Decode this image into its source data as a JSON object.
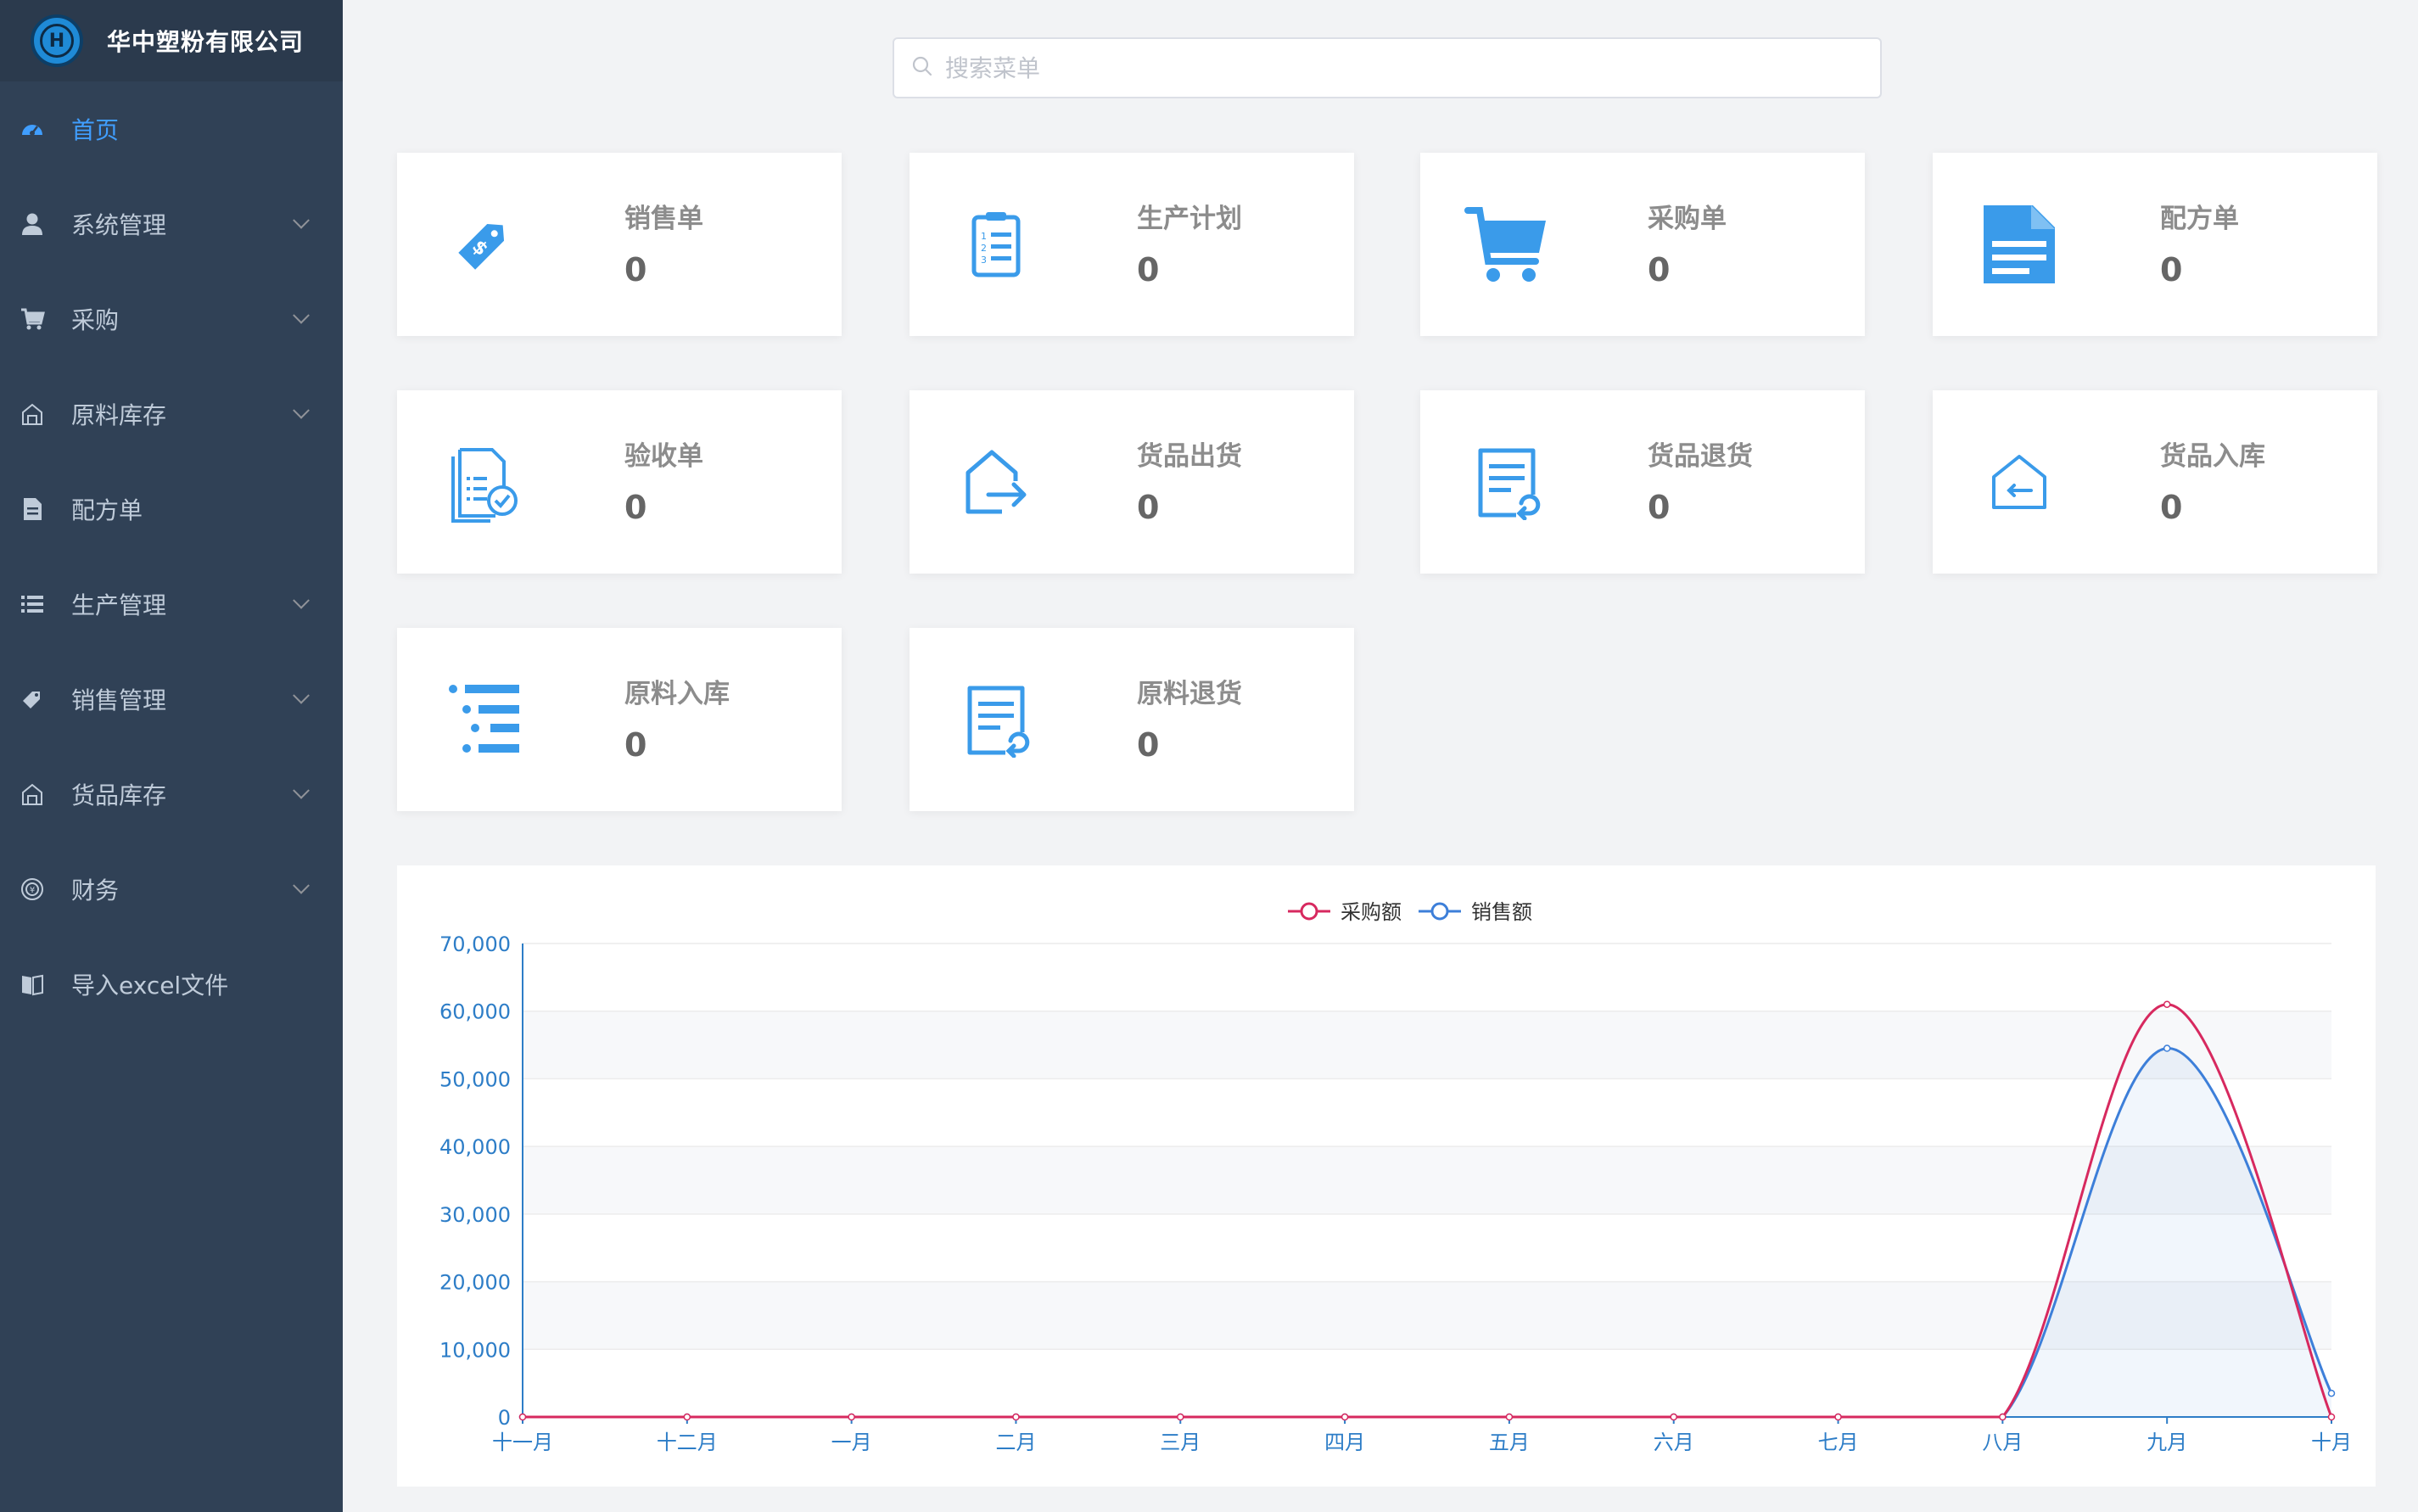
{
  "app": {
    "name": "华中塑粉有限公司",
    "logo_letter": "H"
  },
  "sidebar": {
    "items": [
      {
        "label": "首页",
        "icon": "dashboard-icon",
        "active": true,
        "has_arrow": false
      },
      {
        "label": "系统管理",
        "icon": "user-icon",
        "has_arrow": true
      },
      {
        "label": "采购",
        "icon": "cart-icon",
        "has_arrow": true
      },
      {
        "label": "原料库存",
        "icon": "warehouse-icon",
        "has_arrow": true
      },
      {
        "label": "配方单",
        "icon": "document-icon",
        "has_arrow": false
      },
      {
        "label": "生产管理",
        "icon": "list-icon",
        "has_arrow": true
      },
      {
        "label": "销售管理",
        "icon": "tag-icon",
        "has_arrow": true
      },
      {
        "label": "货品库存",
        "icon": "warehouse-icon",
        "has_arrow": true
      },
      {
        "label": "财务",
        "icon": "coin-icon",
        "has_arrow": true
      },
      {
        "label": "导入excel文件",
        "icon": "book-icon",
        "has_arrow": false
      }
    ]
  },
  "search": {
    "placeholder": "搜索菜单"
  },
  "cards": [
    {
      "title": "销售单",
      "value": "0",
      "icon": "price-tag-icon"
    },
    {
      "title": "生产计划",
      "value": "0",
      "icon": "clipboard-list-icon"
    },
    {
      "title": "采购单",
      "value": "0",
      "icon": "cart-icon"
    },
    {
      "title": "配方单",
      "value": "0",
      "icon": "document-icon"
    },
    {
      "title": "验收单",
      "value": "0",
      "icon": "document-check-icon"
    },
    {
      "title": "货品出货",
      "value": "0",
      "icon": "house-export-icon"
    },
    {
      "title": "货品退货",
      "value": "0",
      "icon": "document-return-icon"
    },
    {
      "title": "货品入库",
      "value": "0",
      "icon": "house-import-icon"
    },
    {
      "title": "原料入库",
      "value": "0",
      "icon": "list-indent-icon"
    },
    {
      "title": "原料退货",
      "value": "0",
      "icon": "document-return-icon"
    }
  ],
  "colors": {
    "accent": "#409eff",
    "icon_blue": "#3a9bea",
    "purchase_line": "#d7295f",
    "sales_line": "#3d7fd9",
    "sidebar_bg": "#304156"
  },
  "chart_data": {
    "type": "line",
    "categories": [
      "十一月",
      "十二月",
      "一月",
      "二月",
      "三月",
      "四月",
      "五月",
      "六月",
      "七月",
      "八月",
      "九月",
      "十月"
    ],
    "series": [
      {
        "name": "采购额",
        "values": [
          0,
          0,
          0,
          0,
          0,
          0,
          0,
          0,
          0,
          0,
          61000,
          0
        ],
        "smooth": true
      },
      {
        "name": "销售额",
        "values": [
          0,
          0,
          0,
          0,
          0,
          0,
          0,
          0,
          0,
          0,
          54500,
          3500
        ],
        "smooth": true,
        "area": true
      }
    ],
    "yticks": [
      "0",
      "10,000",
      "20,000",
      "30,000",
      "40,000",
      "50,000",
      "60,000",
      "70,000"
    ],
    "ylim": [
      0,
      70000
    ],
    "legend": "top-center",
    "grid": true
  }
}
